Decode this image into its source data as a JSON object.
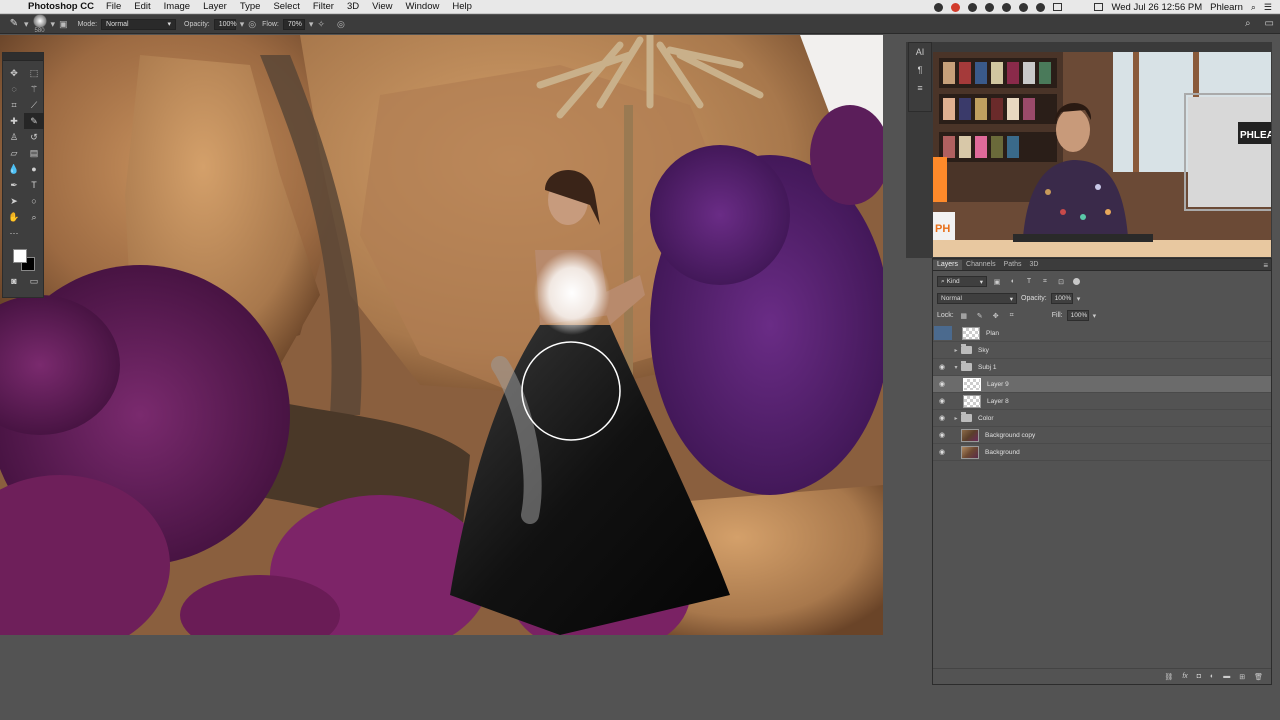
{
  "menubar": {
    "app_name": "Photoshop CC",
    "items": [
      "File",
      "Edit",
      "Image",
      "Layer",
      "Type",
      "Select",
      "Filter",
      "3D",
      "View",
      "Window",
      "Help"
    ],
    "clock": "Wed Jul 26  12:56 PM",
    "user": "Phlearn"
  },
  "options": {
    "brush_size": "580",
    "mode_label": "Mode:",
    "mode_value": "Normal",
    "opacity_label": "Opacity:",
    "opacity_value": "100%",
    "flow_label": "Flow:",
    "flow_value": "70%"
  },
  "webcam": {
    "side_icons": [
      "AI",
      "¶",
      "≡"
    ],
    "monitor_text": "PHLEA",
    "logo_text": "PH"
  },
  "layers_panel": {
    "tabs": [
      "Layers",
      "Channels",
      "Paths",
      "3D"
    ],
    "filter_value": "Kind",
    "blend_mode": "Normal",
    "opacity_label": "Opacity:",
    "opacity_value": "100%",
    "lock_label": "Lock:",
    "fill_label": "Fill:",
    "fill_value": "100%",
    "layers": [
      {
        "name": "Plan",
        "type": "layer",
        "visible": false,
        "selected": false
      },
      {
        "name": "Sky",
        "type": "group",
        "visible": false,
        "selected": false
      },
      {
        "name": "Subj 1",
        "type": "group",
        "visible": true,
        "selected": false
      },
      {
        "name": "Layer 9",
        "type": "layer",
        "visible": true,
        "selected": true
      },
      {
        "name": "Layer 8",
        "type": "layer",
        "visible": true,
        "selected": false
      },
      {
        "name": "Color",
        "type": "group",
        "visible": true,
        "selected": false
      },
      {
        "name": "Background copy",
        "type": "photo",
        "visible": true,
        "selected": false
      },
      {
        "name": "Background",
        "type": "photo",
        "visible": true,
        "selected": false,
        "locked": true
      }
    ]
  },
  "colors": {
    "accent_selection": "#4b6a8e",
    "panel_bg": "#535353",
    "foreground_swatch": "#ffffff",
    "background_swatch": "#000000"
  }
}
